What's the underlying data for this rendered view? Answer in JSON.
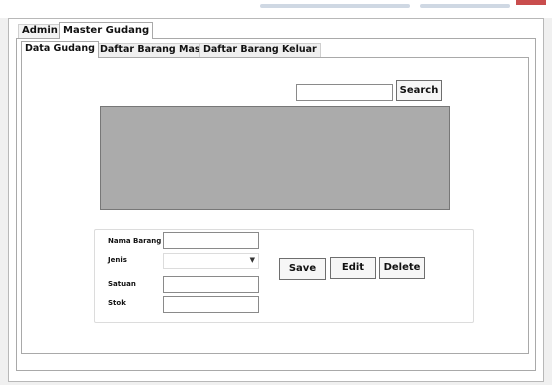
{
  "outer_tabs": [
    "Admin",
    "Master Gudang"
  ],
  "inner_tabs": [
    "Data Gudang",
    "Daftar Barang Masuk",
    "Daftar Barang Keluar"
  ],
  "search": {
    "value": "",
    "button_label": "Search"
  },
  "form": {
    "fields": [
      {
        "label": "Nama Barang",
        "value": ""
      },
      {
        "label": "Jenis",
        "value": ""
      },
      {
        "label": "Satuan",
        "value": ""
      },
      {
        "label": "Stok",
        "value": ""
      }
    ]
  },
  "actions": {
    "save_label": "Save",
    "edit_label": "Edit",
    "delete_label": "Delete"
  },
  "colors": {
    "grid_background": "#ababab",
    "window_background": "#ffffff",
    "close_accent": "#c94d4d"
  },
  "icons": {
    "dropdown": "chevron-down-icon"
  }
}
